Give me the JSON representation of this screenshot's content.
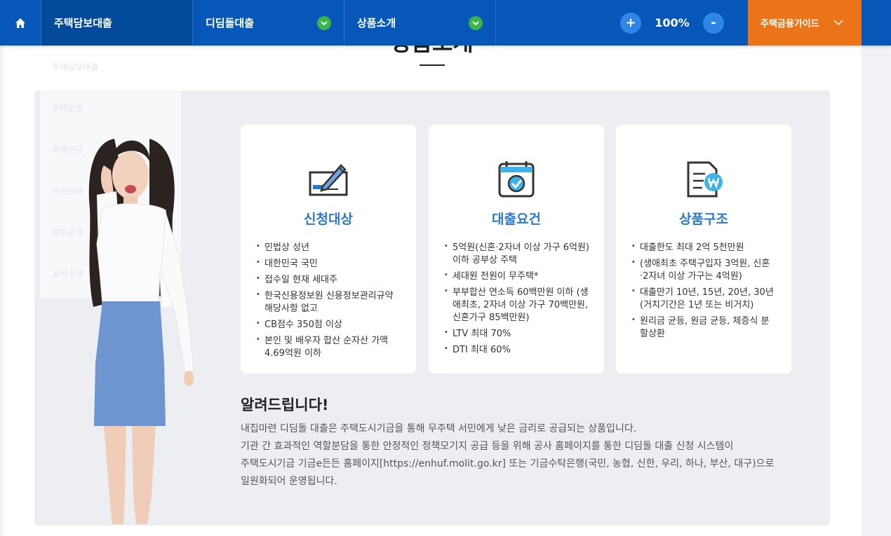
{
  "nav": {
    "home_icon": "home-icon",
    "menus": [
      {
        "label": "주택담보대출",
        "active": true
      },
      {
        "label": "디딤돌대출"
      },
      {
        "label": "상품소개"
      }
    ],
    "zoom": {
      "plus": "+",
      "value": "100%",
      "minus": "-"
    },
    "guide": "주택금융가이드"
  },
  "colors": {
    "nav": "#0757b8",
    "nav_active": "#044a9b",
    "guide": "#eb7418",
    "accent": "#2c79cc",
    "green": "#3bb54a"
  },
  "ghost_menu": [
    "주택담보대출",
    "주택보증",
    "주택연금",
    "국민참여",
    "정보공개",
    "공사소개"
  ],
  "section_title": "상품소개",
  "cards": [
    {
      "icon": "signing-pen-icon",
      "title": "신청대상",
      "items": [
        "민법상 성년",
        "대한민국 국민",
        "접수일 현재 세대주",
        "한국신용정보원 신용정보관리규약 해당사항 없고",
        "CB점수 350점 이상",
        "본인 및 배우자 합산 순자산 가액 4.69억원 이하"
      ]
    },
    {
      "icon": "calendar-check-icon",
      "title": "대출요건",
      "items": [
        "5억원(신혼·2자녀 이상 가구 6억원) 이하 공부상 주택",
        "세대원 전원이 무주택*",
        "부부합산 연소득 60백만원 이하 (생애최초, 2자녀 이상 가구 70백만원, 신혼가구 85백만원)",
        "LTV 최대 70%",
        "DTI 최대 60%"
      ]
    },
    {
      "icon": "document-won-icon",
      "title": "상품구조",
      "items": [
        "대출한도 최대 2억 5천만원",
        "(생애최초 주택구입자 3억원, 신혼·2자녀 이상 가구는 4억원)",
        "대출만기 10년, 15년, 20년, 30년 (거치기간은 1년 또는 비거치)",
        "원리금 균등, 원금 균등, 체증식 분할상환"
      ]
    }
  ],
  "notice": {
    "title": "알려드립니다!",
    "lines": [
      "내집마련 디딤돌 대출은 주택도시기금을 통해 무주택 서민에게 낮은 금리로 공급되는 상품입니다.",
      "기관 간 효과적인 역할분담을 통한 안정적인 정책모기지 공급 등을 위해 공사 홈페이지를 통한 디딤돌 대출 신청 시스템이",
      "주택도시기금 기금e든든 홈페이지[https://enhuf.molit.go.kr] 또는 기금수탁은행(국민, 농협, 신한, 우리, 하나, 부산, 대구)으로",
      "일원화되어 운영됩니다."
    ]
  }
}
